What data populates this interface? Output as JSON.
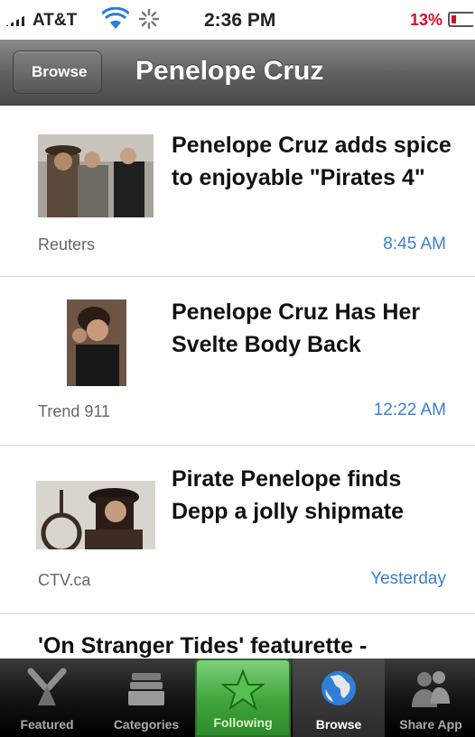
{
  "status_bar": {
    "carrier": "AT&T",
    "time": "2:36 PM",
    "battery": "13%"
  },
  "nav": {
    "back_label": "Browse",
    "title": "Penelope Cruz"
  },
  "articles": [
    {
      "headline": "Penelope Cruz adds spice to enjoyable \"Pirates 4\"",
      "source": "Reuters",
      "time": "8:45 AM"
    },
    {
      "headline": "Penelope Cruz Has Her Svelte Body Back",
      "source": "Trend 911",
      "time": "12:22 AM"
    },
    {
      "headline": "Pirate Penelope finds Depp a jolly shipmate",
      "source": "CTV.ca",
      "time": "Yesterday"
    },
    {
      "headline": "'On Stranger Tides' featurette -"
    }
  ],
  "tabs": [
    {
      "label": "Featured",
      "icon": "featured-icon"
    },
    {
      "label": "Categories",
      "icon": "categories-icon"
    },
    {
      "label": "Following",
      "icon": "star-icon"
    },
    {
      "label": "Browse",
      "icon": "globe-icon"
    },
    {
      "label": "Share App",
      "icon": "people-icon"
    }
  ],
  "colors": {
    "accent_time": "#3b7fd6",
    "battery_low": "#d0102a",
    "selected_tab": "#3fa43a"
  }
}
